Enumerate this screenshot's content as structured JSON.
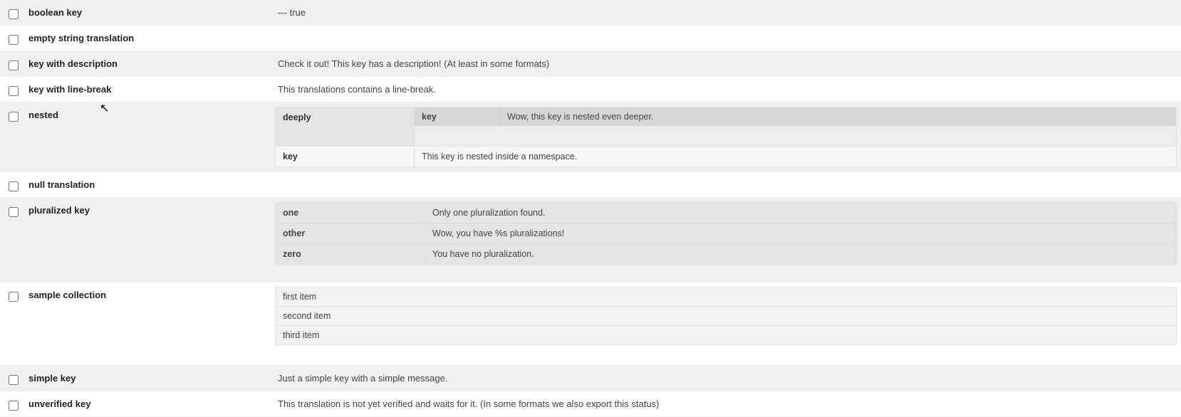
{
  "rows": [
    {
      "key": "boolean key",
      "value": "--- true",
      "alt": true
    },
    {
      "key": "empty string translation",
      "value": "",
      "alt": false
    },
    {
      "key": "key with description",
      "value": "Check it out! This key has a description! (At least in some formats)",
      "alt": true
    },
    {
      "key": "key with line-break",
      "value": "This translations contains a line-break.",
      "alt": false
    },
    {
      "key": "nested",
      "alt": true,
      "nested": {
        "deeply": {
          "key_label": "key",
          "key_value": "Wow, this key is nested even deeper."
        },
        "key": {
          "label": "key",
          "value": "This key is nested inside a namespace."
        },
        "deeply_label": "deeply"
      }
    },
    {
      "key": "null translation",
      "value": "",
      "alt": false
    },
    {
      "key": "pluralized key",
      "alt": true,
      "plural": [
        {
          "k": "one",
          "v": "Only one pluralization found."
        },
        {
          "k": "other",
          "v": "Wow, you have %s pluralizations!"
        },
        {
          "k": "zero",
          "v": "You have no pluralization."
        }
      ]
    },
    {
      "key": "sample collection",
      "alt": false,
      "list": [
        "first item",
        "second item",
        "third item"
      ]
    },
    {
      "key": "simple key",
      "value": "Just a simple key with a simple message.",
      "alt": true
    },
    {
      "key": "unverified key",
      "value": "This translation is not yet verified and waits for it. (In some formats we also export this status)",
      "alt": false
    }
  ]
}
